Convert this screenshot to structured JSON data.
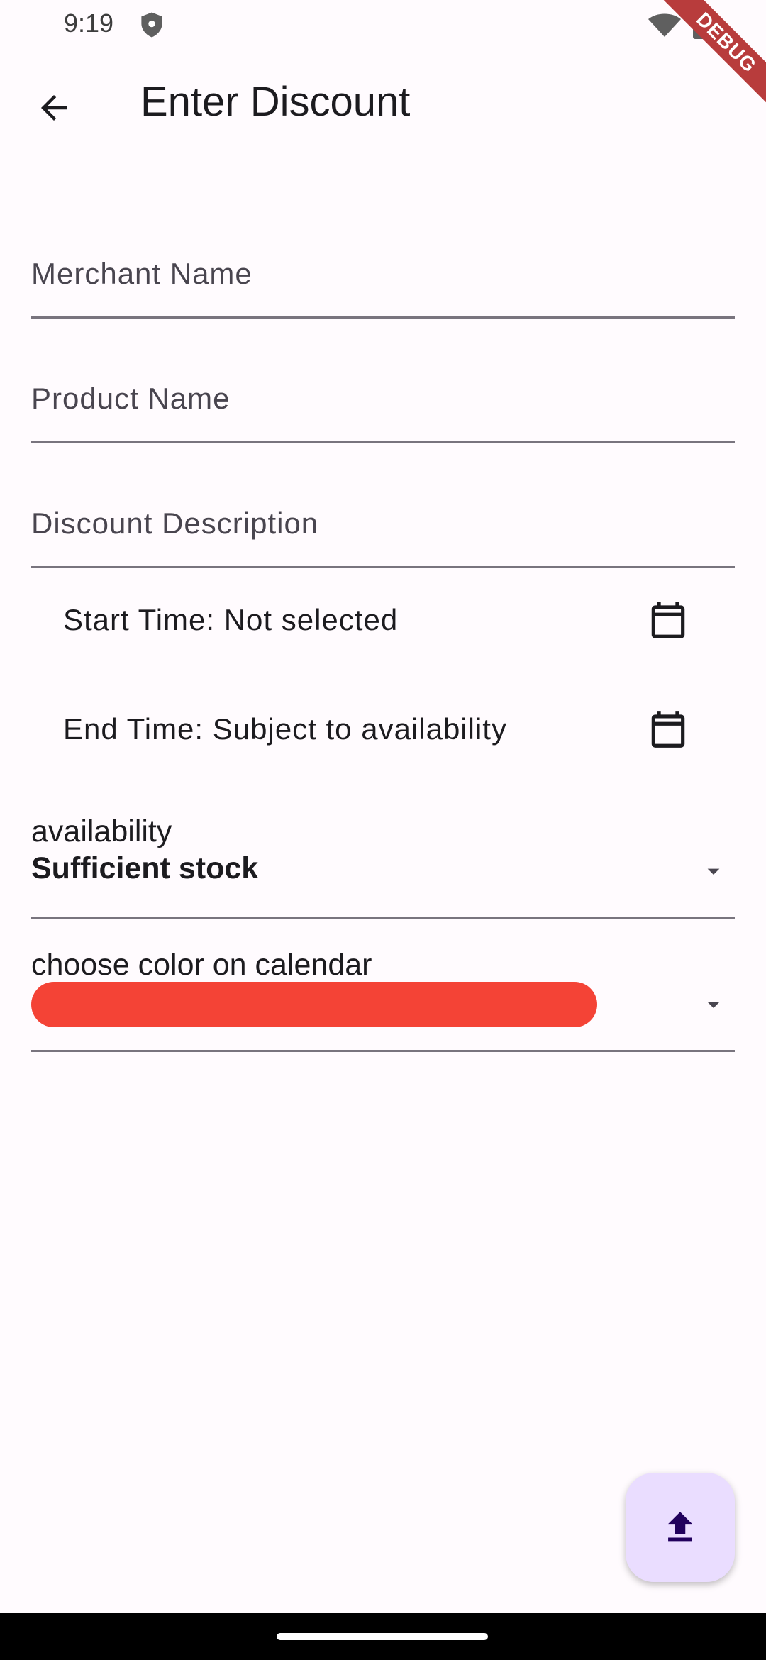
{
  "status_bar": {
    "time": "9:19",
    "icons": [
      "shield-icon",
      "wifi-icon",
      "battery-icon"
    ]
  },
  "debug_banner": "DEBUG",
  "app_bar": {
    "title": "Enter Discount",
    "back_icon": "arrow-back-icon"
  },
  "form": {
    "merchant_name_label": "Merchant Name",
    "product_name_label": "Product Name",
    "discount_description_label": "Discount Description",
    "start_time": "Start Time: Not selected",
    "end_time": "End Time: Subject to availability",
    "availability": {
      "label": "availability",
      "value": "Sufficient stock"
    },
    "calendar_color": {
      "label": "choose color on calendar",
      "selected_color": "#F44336"
    }
  },
  "fab": {
    "icon": "upload-icon"
  },
  "colors": {
    "background": "#FFFBFE",
    "underline": "#79747E",
    "fab_bg": "#EADDFF",
    "fab_icon": "#21005D",
    "debug": "#B83C3C"
  }
}
